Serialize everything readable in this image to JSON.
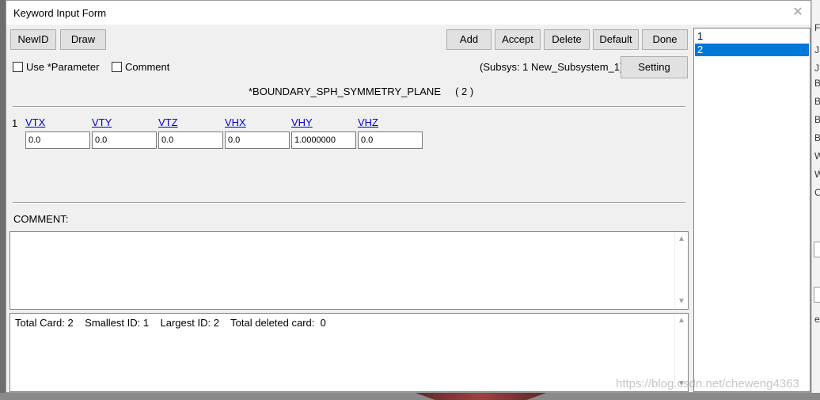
{
  "window": {
    "title": "Keyword Input Form",
    "close_glyph": "✕"
  },
  "toolbar": {
    "newid": "NewID",
    "draw": "Draw",
    "add": "Add",
    "accept": "Accept",
    "delete": "Delete",
    "default": "Default",
    "done": "Done",
    "setting": "Setting"
  },
  "options": {
    "use_parameter": "Use *Parameter",
    "comment": "Comment"
  },
  "subsystem": "(Subsys: 1 New_Subsystem_1)",
  "keyword": {
    "name": "*BOUNDARY_SPH_SYMMETRY_PLANE",
    "count": "( 2 )"
  },
  "card": {
    "row_number": "1",
    "fields": [
      {
        "label": "VTX",
        "value": "0.0"
      },
      {
        "label": "VTY",
        "value": "0.0"
      },
      {
        "label": "VTZ",
        "value": "0.0"
      },
      {
        "label": "VHX",
        "value": "0.0"
      },
      {
        "label": "VHY",
        "value": "1.0000000"
      },
      {
        "label": "VHZ",
        "value": "0.0"
      }
    ]
  },
  "comment_label": "COMMENT:",
  "comment_text": "",
  "status": "Total Card: 2    Smallest ID: 1    Largest ID: 2    Total deleted card:  0",
  "id_list": {
    "items": [
      "1",
      "2"
    ],
    "selected": "2"
  },
  "watermark": "https://blog.csdn.net/cheweng4363",
  "background_fragments": [
    "F",
    "JF",
    "JF",
    "BU",
    "BU",
    "BU",
    "BU",
    "WI",
    "WI",
    "C",
    "ex"
  ]
}
